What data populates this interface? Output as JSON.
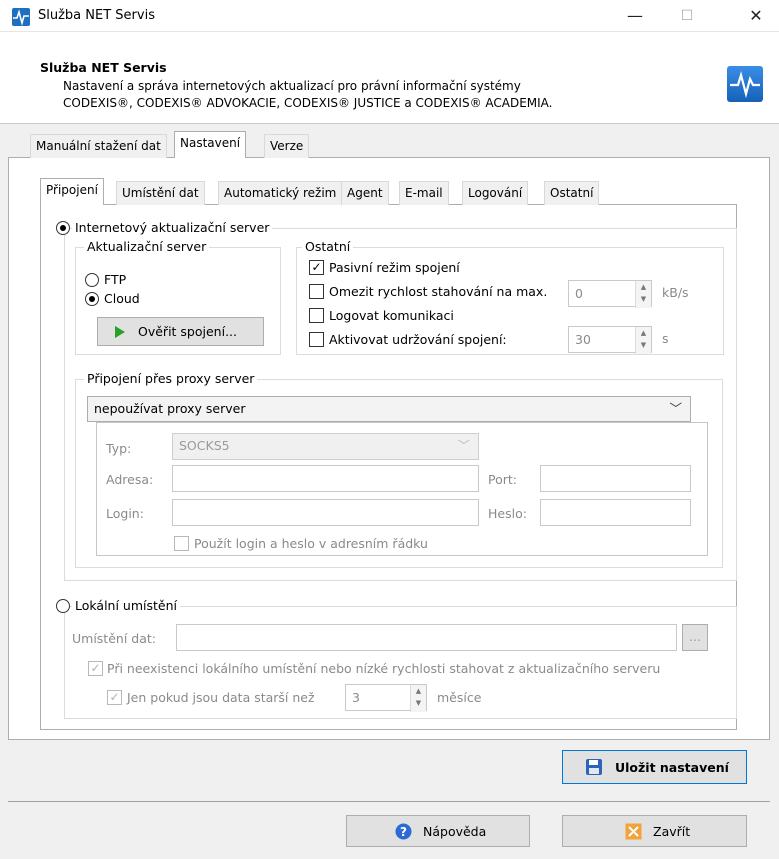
{
  "window": {
    "title": "Služba NET Servis",
    "minimize": "—",
    "maximize": "☐",
    "close": "✕"
  },
  "header": {
    "title": "Služba NET Servis",
    "desc_line1": "Nastavení a správa internetových aktualizací pro právní informační systémy",
    "desc_line2": "CODEXIS®, CODEXIS® ADVOKACIE, CODEXIS® JUSTICE a CODEXIS® ACADEMIA."
  },
  "main_tabs": [
    "Manuální stažení dat",
    "Nastavení",
    "Verze"
  ],
  "sub_tabs": [
    "Připojení",
    "Umístění dat",
    "Automatický režim",
    "Agent",
    "E-mail",
    "Logování",
    "Ostatní"
  ],
  "internet": {
    "label": "Internetový aktualizační server",
    "selected": true,
    "server_group": {
      "label": "Aktualizační server",
      "ftp": "FTP",
      "cloud": "Cloud",
      "selected": "Cloud",
      "verify_button": "Ověřit spojení..."
    },
    "other_group": {
      "label": "Ostatní",
      "passive": {
        "label": "Pasivní režim spojení",
        "checked": true
      },
      "limit": {
        "label": "Omezit rychlost stahování na max.",
        "checked": false,
        "value": "0",
        "unit": "kB/s"
      },
      "log": {
        "label": "Logovat komunikaci",
        "checked": false
      },
      "keepalive": {
        "label": "Aktivovat udržování spojení:",
        "checked": false,
        "value": "30",
        "unit": "s"
      }
    },
    "proxy_group": {
      "label": "Připojení přes proxy server",
      "mode": "nepoužívat proxy server",
      "type_label": "Typ:",
      "type_value": "SOCKS5",
      "address_label": "Adresa:",
      "address_value": "",
      "port_label": "Port:",
      "port_value": "",
      "login_label": "Login:",
      "login_value": "",
      "password_label": "Heslo:",
      "password_value": "",
      "use_in_url": {
        "label": "Použít login a heslo v adresním řádku",
        "checked": false
      }
    }
  },
  "local": {
    "label": "Lokální umístění",
    "selected": false,
    "location_label": "Umístění dat:",
    "location_value": "",
    "browse": "...",
    "fallback": {
      "label": "Při neexistenci lokálního umístění nebo nízké rychlosti stahovat z aktualizačního serveru",
      "checked": true
    },
    "older": {
      "label": "Jen pokud jsou data starší než",
      "checked": true,
      "value": "3",
      "unit": "měsíce"
    }
  },
  "save_button": "Uložit nastavení",
  "help_button": "Nápověda",
  "close_button": "Zavřít",
  "colors": {
    "accent": "#0078d7",
    "header_bg": "#ffffff",
    "window_bg": "#f0f0f0"
  }
}
